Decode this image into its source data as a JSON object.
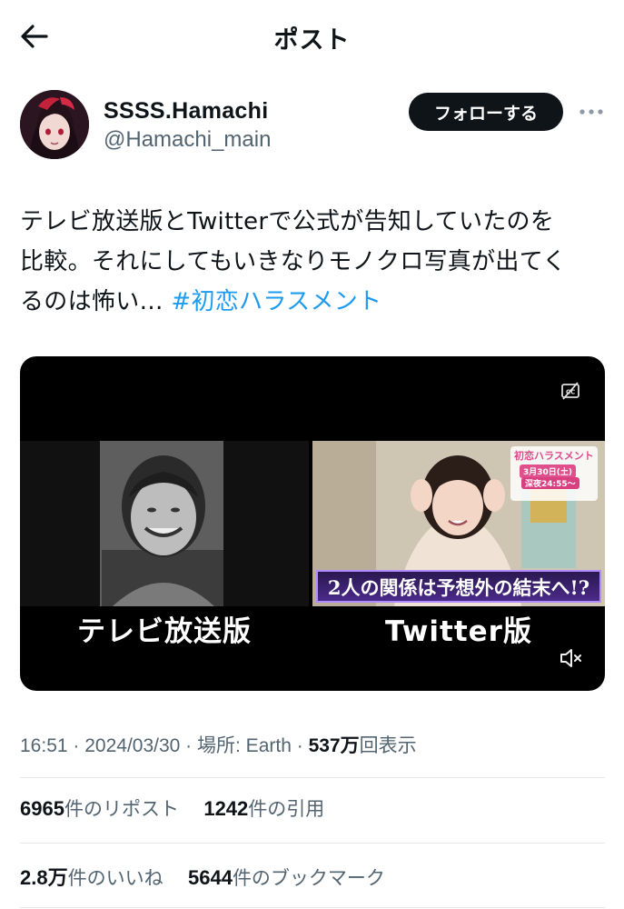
{
  "header": {
    "title": "ポスト",
    "back_icon": "arrow-left-icon"
  },
  "author": {
    "display_name": "SSSS.Hamachi",
    "handle": "@Hamachi_main",
    "follow_label": "フォローする",
    "more_icon": "more-horizontal-icon"
  },
  "tweet": {
    "line1": "テレビ放送版とTwitterで公式が告知していたのを",
    "line2": "比較。それにしてもいきなりモノクロ写真が出てく",
    "line3_text": "るのは怖い… ",
    "hashtag": "#初恋ハラスメント"
  },
  "media": {
    "caption_left": "テレビ放送版",
    "caption_right": "Twitter版",
    "tv_banner": "2人の関係は予想外の結末へ!?",
    "promo_title": "初恋ハラスメント",
    "promo_date": "3月30日(土)",
    "promo_time": "深夜24:55〜",
    "cc_icon": "closed-captions-off-icon",
    "mute_icon": "volume-muted-icon"
  },
  "meta": {
    "time": "16:51",
    "date": "2024/03/30",
    "location_label": "場所: Earth",
    "views_count": "537",
    "views_unit": "万",
    "views_label": "回表示",
    "sep": " · "
  },
  "stats": {
    "reposts_count": "6965",
    "reposts_label": "件のリポスト",
    "quotes_count": "1242",
    "quotes_label": "件の引用",
    "likes_count": "2.8",
    "likes_unit": "万",
    "likes_label": "件のいいね",
    "bookmarks_count": "5644",
    "bookmarks_label": "件のブックマーク"
  },
  "colors": {
    "link": "#1d9bf0",
    "text": "#0f1419",
    "secondary": "#536471",
    "follow_bg": "#0f1419"
  }
}
